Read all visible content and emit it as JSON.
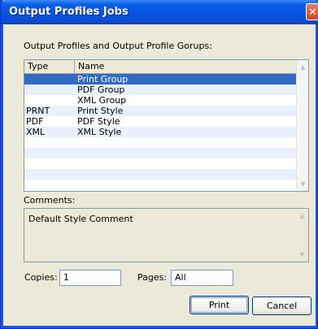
{
  "window": {
    "title": "Output Profiles Jobs",
    "close_glyph": "✕"
  },
  "profiles_label": "Output Profiles and Output Profile Gorups:",
  "list": {
    "columns": [
      "Type",
      "Name"
    ],
    "rows": [
      {
        "type": "",
        "name": "Print Group",
        "selected": true
      },
      {
        "type": "",
        "name": "PDF Group"
      },
      {
        "type": "",
        "name": "XML Group"
      },
      {
        "type": "PRNT",
        "name": "Print Style"
      },
      {
        "type": "PDF",
        "name": "PDF Style"
      },
      {
        "type": "XML",
        "name": "XML  Style"
      }
    ]
  },
  "comments": {
    "label": "Comments:",
    "value": "Default Style Comment"
  },
  "copies": {
    "label": "Copies:",
    "value": "1"
  },
  "pages": {
    "label": "Pages:",
    "value": "All"
  },
  "buttons": {
    "print": "Print",
    "cancel": "Cancel"
  },
  "icons": {
    "up": "up-arrow-icon",
    "down": "down-arrow-icon"
  }
}
